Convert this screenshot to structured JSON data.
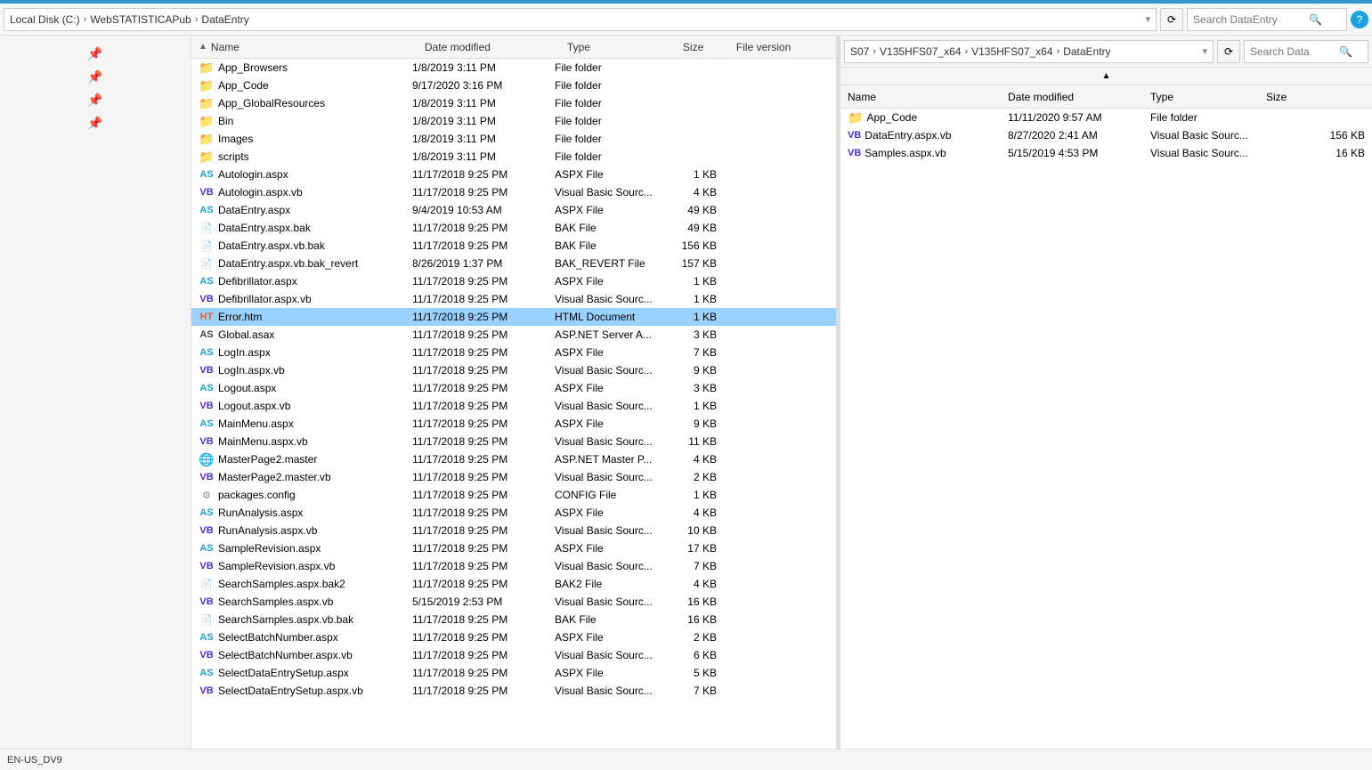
{
  "window": {
    "title": "DataEntry"
  },
  "leftPanel": {
    "breadcrumb": [
      "Local Disk (C:)",
      "WebSTATISTICAPub",
      "DataEntry"
    ],
    "searchPlaceholder": "Search DataEntry",
    "searchLabel": "Search",
    "columns": {
      "name": "Name",
      "dateModified": "Date modified",
      "type": "Type",
      "size": "Size",
      "fileVersion": "File version"
    },
    "files": [
      {
        "name": "App_Browsers",
        "icon": "folder",
        "date": "1/8/2019 3:11 PM",
        "type": "File folder",
        "size": "",
        "ver": ""
      },
      {
        "name": "App_Code",
        "icon": "folder",
        "date": "9/17/2020 3:16 PM",
        "type": "File folder",
        "size": "",
        "ver": ""
      },
      {
        "name": "App_GlobalResources",
        "icon": "folder",
        "date": "1/8/2019 3:11 PM",
        "type": "File folder",
        "size": "",
        "ver": ""
      },
      {
        "name": "Bin",
        "icon": "folder",
        "date": "1/8/2019 3:11 PM",
        "type": "File folder",
        "size": "",
        "ver": ""
      },
      {
        "name": "Images",
        "icon": "folder",
        "date": "1/8/2019 3:11 PM",
        "type": "File folder",
        "size": "",
        "ver": ""
      },
      {
        "name": "scripts",
        "icon": "folder",
        "date": "1/8/2019 3:11 PM",
        "type": "File folder",
        "size": "",
        "ver": ""
      },
      {
        "name": "Autologin.aspx",
        "icon": "aspx",
        "date": "11/17/2018 9:25 PM",
        "type": "ASPX File",
        "size": "1 KB",
        "ver": ""
      },
      {
        "name": "Autologin.aspx.vb",
        "icon": "vb",
        "date": "11/17/2018 9:25 PM",
        "type": "Visual Basic Sourc...",
        "size": "4 KB",
        "ver": ""
      },
      {
        "name": "DataEntry.aspx",
        "icon": "aspx",
        "date": "9/4/2019 10:53 AM",
        "type": "ASPX File",
        "size": "49 KB",
        "ver": ""
      },
      {
        "name": "DataEntry.aspx.bak",
        "icon": "generic",
        "date": "11/17/2018 9:25 PM",
        "type": "BAK File",
        "size": "49 KB",
        "ver": ""
      },
      {
        "name": "DataEntry.aspx.vb.bak",
        "icon": "generic",
        "date": "11/17/2018 9:25 PM",
        "type": "BAK File",
        "size": "156 KB",
        "ver": ""
      },
      {
        "name": "DataEntry.aspx.vb.bak_revert",
        "icon": "generic",
        "date": "8/26/2019 1:37 PM",
        "type": "BAK_REVERT File",
        "size": "157 KB",
        "ver": ""
      },
      {
        "name": "Defibrillator.aspx",
        "icon": "aspx",
        "date": "11/17/2018 9:25 PM",
        "type": "ASPX File",
        "size": "1 KB",
        "ver": ""
      },
      {
        "name": "Defibrillator.aspx.vb",
        "icon": "vb",
        "date": "11/17/2018 9:25 PM",
        "type": "Visual Basic Sourc...",
        "size": "1 KB",
        "ver": ""
      },
      {
        "name": "Error.htm",
        "icon": "html",
        "date": "11/17/2018 9:25 PM",
        "type": "HTML Document",
        "size": "1 KB",
        "ver": "",
        "selected": true
      },
      {
        "name": "Global.asax",
        "icon": "asax",
        "date": "11/17/2018 9:25 PM",
        "type": "ASP.NET Server A...",
        "size": "3 KB",
        "ver": ""
      },
      {
        "name": "LogIn.aspx",
        "icon": "aspx",
        "date": "11/17/2018 9:25 PM",
        "type": "ASPX File",
        "size": "7 KB",
        "ver": ""
      },
      {
        "name": "LogIn.aspx.vb",
        "icon": "vb",
        "date": "11/17/2018 9:25 PM",
        "type": "Visual Basic Sourc...",
        "size": "9 KB",
        "ver": ""
      },
      {
        "name": "Logout.aspx",
        "icon": "aspx",
        "date": "11/17/2018 9:25 PM",
        "type": "ASPX File",
        "size": "3 KB",
        "ver": ""
      },
      {
        "name": "Logout.aspx.vb",
        "icon": "vb",
        "date": "11/17/2018 9:25 PM",
        "type": "Visual Basic Sourc...",
        "size": "1 KB",
        "ver": ""
      },
      {
        "name": "MainMenu.aspx",
        "icon": "aspx",
        "date": "11/17/2018 9:25 PM",
        "type": "ASPX File",
        "size": "9 KB",
        "ver": ""
      },
      {
        "name": "MainMenu.aspx.vb",
        "icon": "vb",
        "date": "11/17/2018 9:25 PM",
        "type": "Visual Basic Sourc...",
        "size": "11 KB",
        "ver": ""
      },
      {
        "name": "MasterPage2.master",
        "icon": "master",
        "date": "11/17/2018 9:25 PM",
        "type": "ASP.NET Master P...",
        "size": "4 KB",
        "ver": ""
      },
      {
        "name": "MasterPage2.master.vb",
        "icon": "vb",
        "date": "11/17/2018 9:25 PM",
        "type": "Visual Basic Sourc...",
        "size": "2 KB",
        "ver": ""
      },
      {
        "name": "packages.config",
        "icon": "config",
        "date": "11/17/2018 9:25 PM",
        "type": "CONFIG File",
        "size": "1 KB",
        "ver": ""
      },
      {
        "name": "RunAnalysis.aspx",
        "icon": "aspx",
        "date": "11/17/2018 9:25 PM",
        "type": "ASPX File",
        "size": "4 KB",
        "ver": ""
      },
      {
        "name": "RunAnalysis.aspx.vb",
        "icon": "vb",
        "date": "11/17/2018 9:25 PM",
        "type": "Visual Basic Sourc...",
        "size": "10 KB",
        "ver": ""
      },
      {
        "name": "SampleRevision.aspx",
        "icon": "aspx",
        "date": "11/17/2018 9:25 PM",
        "type": "ASPX File",
        "size": "17 KB",
        "ver": ""
      },
      {
        "name": "SampleRevision.aspx.vb",
        "icon": "vb",
        "date": "11/17/2018 9:25 PM",
        "type": "Visual Basic Sourc...",
        "size": "7 KB",
        "ver": ""
      },
      {
        "name": "SearchSamples.aspx.bak2",
        "icon": "generic",
        "date": "11/17/2018 9:25 PM",
        "type": "BAK2 File",
        "size": "4 KB",
        "ver": ""
      },
      {
        "name": "SearchSamples.aspx.vb",
        "icon": "vb",
        "date": "5/15/2019 2:53 PM",
        "type": "Visual Basic Sourc...",
        "size": "16 KB",
        "ver": ""
      },
      {
        "name": "SearchSamples.aspx.vb.bak",
        "icon": "generic",
        "date": "11/17/2018 9:25 PM",
        "type": "BAK File",
        "size": "16 KB",
        "ver": ""
      },
      {
        "name": "SelectBatchNumber.aspx",
        "icon": "aspx",
        "date": "11/17/2018 9:25 PM",
        "type": "ASPX File",
        "size": "2 KB",
        "ver": ""
      },
      {
        "name": "SelectBatchNumber.aspx.vb",
        "icon": "vb",
        "date": "11/17/2018 9:25 PM",
        "type": "Visual Basic Sourc...",
        "size": "6 KB",
        "ver": ""
      },
      {
        "name": "SelectDataEntrySetup.aspx",
        "icon": "aspx",
        "date": "11/17/2018 9:25 PM",
        "type": "ASPX File",
        "size": "5 KB",
        "ver": ""
      },
      {
        "name": "SelectDataEntrySetup.aspx.vb",
        "icon": "vb",
        "date": "11/17/2018 9:25 PM",
        "type": "Visual Basic Sourc...",
        "size": "7 KB",
        "ver": ""
      }
    ]
  },
  "rightPanel": {
    "breadcrumb": [
      "S07",
      "V135HFS07_x64",
      "V135HFS07_x64",
      "DataEntry"
    ],
    "searchLabel": "Search Data",
    "columns": {
      "name": "Name",
      "dateModified": "Date modified",
      "type": "Type",
      "size": "Size"
    },
    "files": [
      {
        "name": "App_Code",
        "icon": "folder",
        "date": "11/11/2020 9:57 AM",
        "type": "File folder",
        "size": ""
      },
      {
        "name": "DataEntry.aspx.vb",
        "icon": "vb",
        "date": "8/27/2020 2:41 AM",
        "type": "Visual Basic Sourc...",
        "size": "156 KB"
      },
      {
        "name": "Samples.aspx.vb",
        "icon": "vb",
        "date": "5/15/2019 4:53 PM",
        "type": "Visual Basic Sourc...",
        "size": "16 KB"
      }
    ]
  },
  "statusbar": {
    "locale": "EN-US_DV9"
  },
  "icons": {
    "folder": "📁",
    "up": "↑",
    "refresh": "⟳",
    "search": "🔍",
    "close": "✕",
    "minimize": "─",
    "maximize": "□",
    "help": "?"
  }
}
